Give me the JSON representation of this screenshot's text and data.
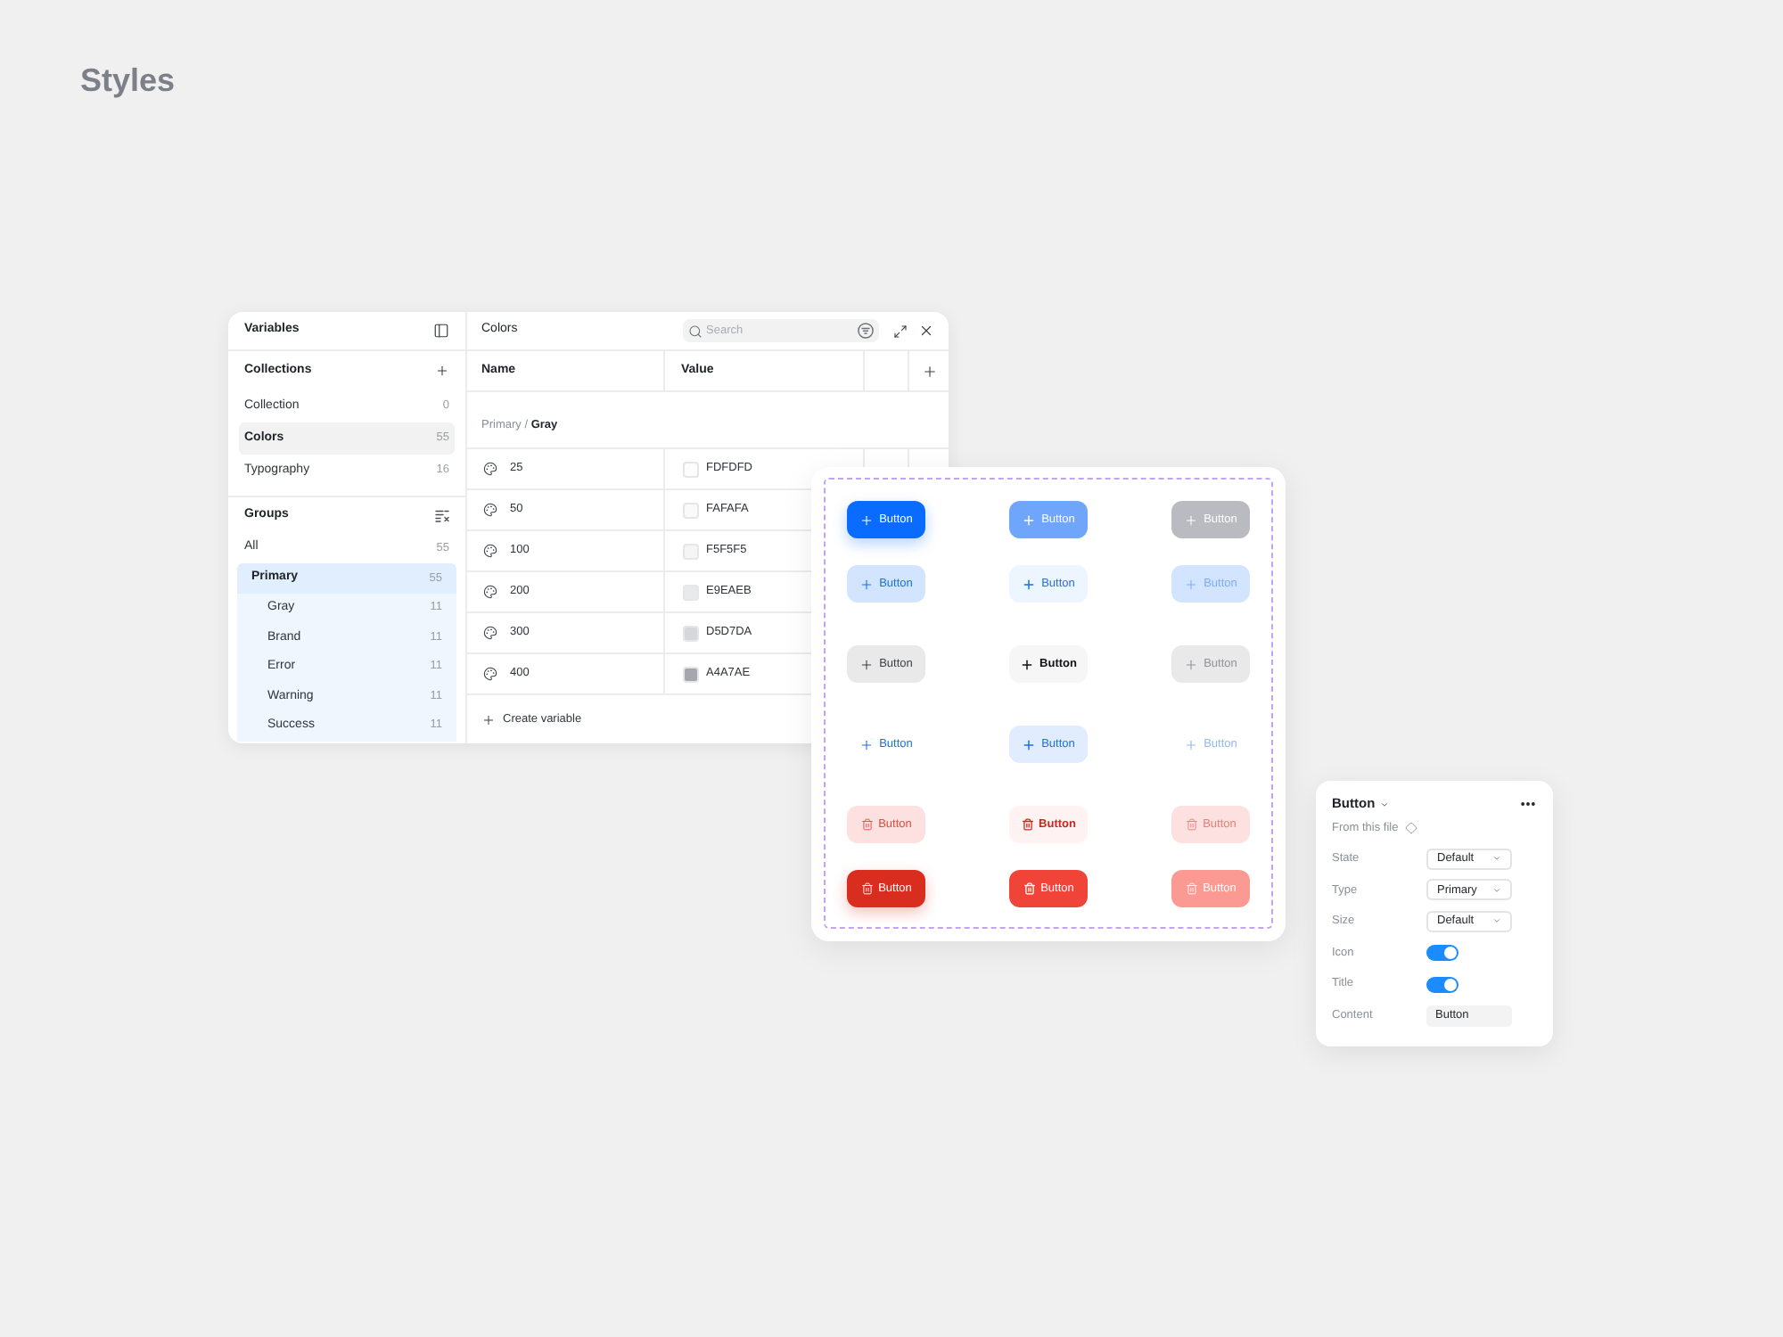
{
  "page": {
    "title": "Styles"
  },
  "variables_panel": {
    "sidebar": {
      "title": "Variables",
      "collections": {
        "title": "Collections",
        "items": [
          {
            "label": "Collection",
            "count": "0",
            "selected": false
          },
          {
            "label": "Colors",
            "count": "55",
            "selected": true
          },
          {
            "label": "Typography",
            "count": "16",
            "selected": false
          }
        ]
      },
      "groups": {
        "title": "Groups",
        "items": [
          {
            "label": "All",
            "count": "55",
            "selected": false
          },
          {
            "label": "Primary",
            "count": "55",
            "selected": true,
            "expanded": true,
            "children": [
              {
                "label": "Gray",
                "count": "11",
                "selected": false
              },
              {
                "label": "Brand",
                "count": "11",
                "selected": false
              },
              {
                "label": "Error",
                "count": "11",
                "selected": false
              },
              {
                "label": "Warning",
                "count": "11",
                "selected": false
              },
              {
                "label": "Success",
                "count": "11",
                "selected": false
              }
            ]
          }
        ]
      }
    },
    "main": {
      "title": "Colors",
      "search": {
        "placeholder": "Search"
      },
      "table": {
        "columns": [
          "Name",
          "Value"
        ],
        "group_path": "Primary / **Gray**",
        "rows": [
          {
            "name": "25",
            "value": "FDFDFD",
            "color": "#fdfdfd"
          },
          {
            "name": "50",
            "value": "FAFAFA",
            "color": "#fafafa"
          },
          {
            "name": "100",
            "value": "F5F5F5",
            "color": "#f5f5f5"
          },
          {
            "name": "200",
            "value": "E9EAEB",
            "color": "#e9eaeb"
          },
          {
            "name": "300",
            "value": "D5D7DA",
            "color": "#d5d7da"
          },
          {
            "name": "400",
            "value": "A4A7AE",
            "color": "#a4a7ae"
          }
        ]
      },
      "create_button": "Create variable"
    }
  },
  "button_grid": {
    "rows": [
      {
        "kind": "primary",
        "buttons": [
          {
            "label": "Button",
            "hovered": false,
            "disabled": false
          },
          {
            "label": "Button",
            "hovered": true,
            "disabled": false
          },
          {
            "label": "Button",
            "hovered": false,
            "disabled": true
          }
        ]
      },
      {
        "kind": "secondary",
        "buttons": [
          {
            "label": "Button",
            "hovered": false,
            "disabled": false
          },
          {
            "label": "Button",
            "hovered": true,
            "disabled": false
          },
          {
            "label": "Button",
            "hovered": false,
            "disabled": true
          }
        ]
      },
      {
        "kind": "tertiary",
        "buttons": [
          {
            "label": "Button",
            "hovered": false,
            "disabled": false
          },
          {
            "label": "Button",
            "hovered": true,
            "disabled": false
          },
          {
            "label": "Button",
            "hovered": false,
            "disabled": true
          }
        ]
      },
      {
        "kind": "ghost",
        "buttons": [
          {
            "label": "Button",
            "hovered": false,
            "disabled": false
          },
          {
            "label": "Button",
            "hovered": true,
            "disabled": false
          },
          {
            "label": "Button",
            "hovered": false,
            "disabled": true
          }
        ]
      },
      {
        "kind": "danger_soft",
        "buttons": [
          {
            "label": "Button",
            "hovered": false,
            "disabled": false
          },
          {
            "label": "Button",
            "hovered": true,
            "disabled": false
          },
          {
            "label": "Button",
            "hovered": false,
            "disabled": true
          }
        ]
      },
      {
        "kind": "danger",
        "buttons": [
          {
            "label": "Button",
            "hovered": false,
            "disabled": false
          },
          {
            "label": "Button",
            "hovered": true,
            "disabled": false
          },
          {
            "label": "Button",
            "hovered": false,
            "disabled": true
          }
        ]
      }
    ]
  },
  "properties_panel": {
    "title": "Button",
    "source": "From this file",
    "rows": [
      {
        "kind": "select",
        "label": "State",
        "value": "Default"
      },
      {
        "kind": "select",
        "label": "Type",
        "value": "Primary"
      },
      {
        "kind": "select",
        "label": "Size",
        "value": "Default"
      },
      {
        "kind": "toggle",
        "label": "Icon",
        "on": true
      },
      {
        "kind": "toggle",
        "label": "Title",
        "on": true
      },
      {
        "kind": "text",
        "label": "Content",
        "value": "Button"
      }
    ]
  }
}
